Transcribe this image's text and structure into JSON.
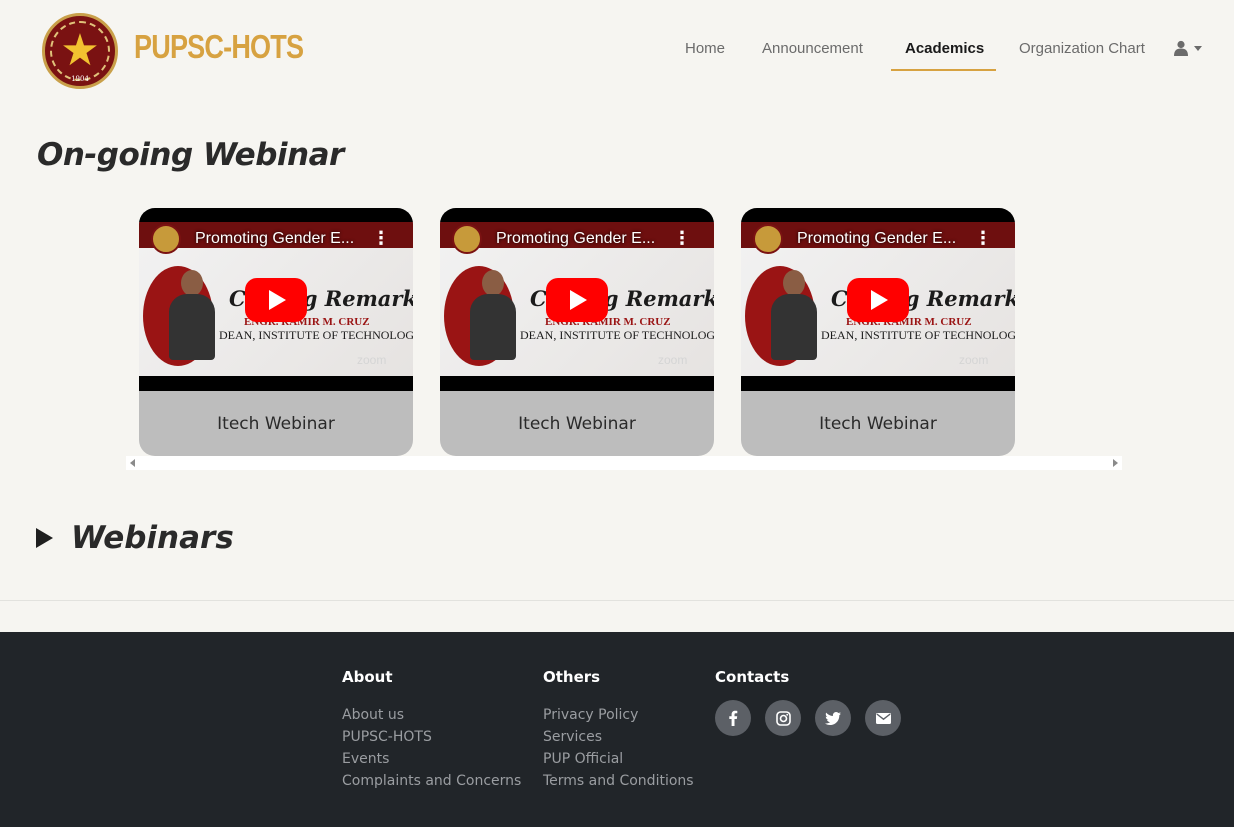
{
  "header": {
    "brand": "PUPSC-HOTS",
    "logo_year": "1904",
    "nav": [
      {
        "label": "Home"
      },
      {
        "label": "Announcement"
      },
      {
        "label": "Academics"
      },
      {
        "label": "Organization Chart"
      }
    ],
    "active_nav": "Academics",
    "accent_color": "#d7a241"
  },
  "ongoing": {
    "title": "On-going Webinar",
    "cards": [
      {
        "video_title": "Promoting Gender E...",
        "thumb_heading": "Closing Remarks",
        "thumb_name": "ENGR. RAMIR M. CRUZ",
        "thumb_role": "DEAN, INSTITUTE OF TECHNOLOGY",
        "thumb_watermark": "zoom",
        "label": "Itech Webinar"
      },
      {
        "video_title": "Promoting Gender E...",
        "thumb_heading": "Closing Remarks",
        "thumb_name": "ENGR. RAMIR M. CRUZ",
        "thumb_role": "DEAN, INSTITUTE OF TECHNOLOGY",
        "thumb_watermark": "zoom",
        "label": "Itech Webinar"
      },
      {
        "video_title": "Promoting Gender E...",
        "thumb_heading": "Closing Remarks",
        "thumb_name": "ENGR. RAMIR M. CRUZ",
        "thumb_role": "DEAN, INSTITUTE OF TECHNOLOGY",
        "thumb_watermark": "zoom",
        "label": "Itech Webinar"
      }
    ]
  },
  "webinars": {
    "title": "Webinars"
  },
  "footer": {
    "about": {
      "heading": "About",
      "links": [
        "About us",
        "PUPSC-HOTS",
        "Events",
        "Complaints and Concerns"
      ]
    },
    "others": {
      "heading": "Others",
      "links": [
        "Privacy Policy",
        "Services",
        "PUP Official",
        "Terms and Conditions"
      ]
    },
    "contacts": {
      "heading": "Contacts",
      "icons": [
        "facebook-icon",
        "instagram-icon",
        "twitter-icon",
        "email-icon"
      ]
    },
    "background": "#212529"
  }
}
